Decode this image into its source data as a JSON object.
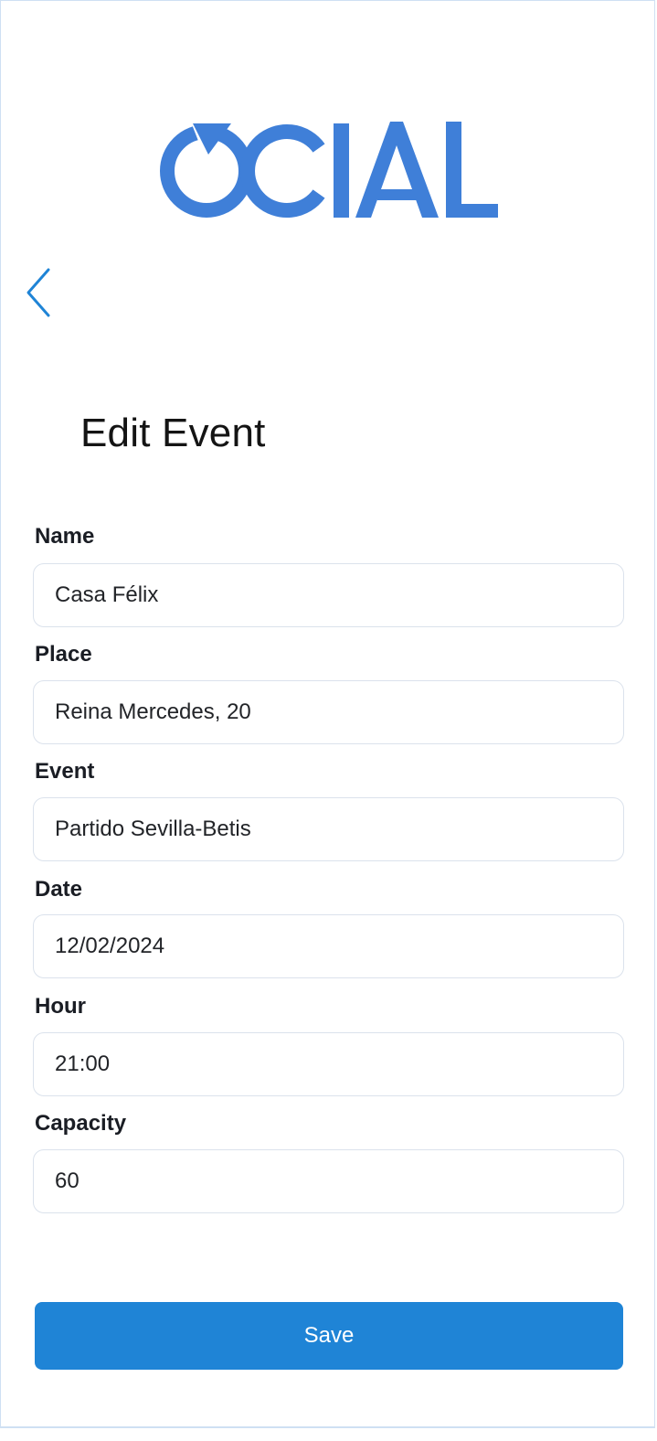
{
  "brand": {
    "logo_text": "OCIAL",
    "logo_color": "#3f7fd8"
  },
  "nav": {
    "back_icon": "chevron-left-icon",
    "back_color": "#1f84d6"
  },
  "page": {
    "title": "Edit Event"
  },
  "form": {
    "name": {
      "label": "Name",
      "value": "Casa Félix"
    },
    "place": {
      "label": "Place",
      "value": "Reina Mercedes, 20"
    },
    "event": {
      "label": "Event",
      "value": "Partido Sevilla-Betis"
    },
    "date": {
      "label": "Date",
      "value": "12/02/2024"
    },
    "hour": {
      "label": "Hour",
      "value": "21:00"
    },
    "capacity": {
      "label": "Capacity",
      "value": "60"
    }
  },
  "actions": {
    "save_label": "Save",
    "save_color": "#1f84d6"
  }
}
